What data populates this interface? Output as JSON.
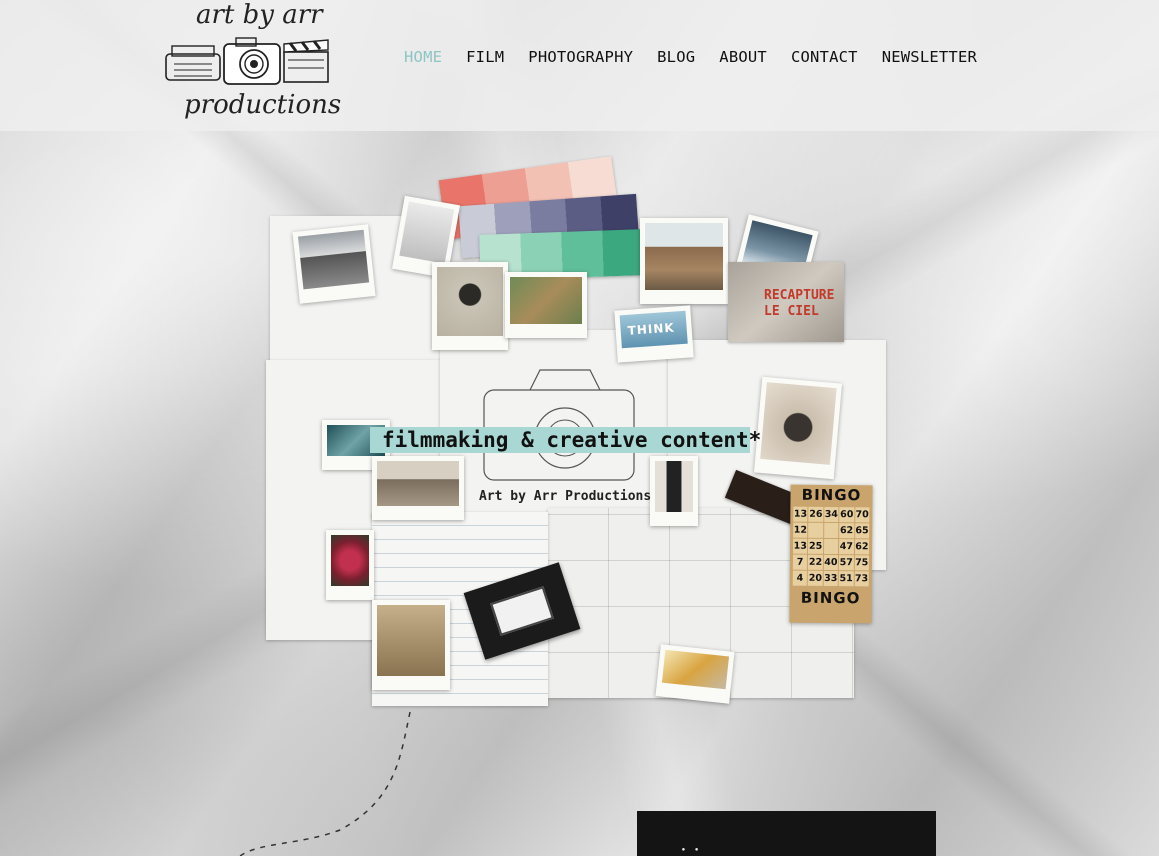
{
  "brand": {
    "logo_line1": "art by arr",
    "logo_line2": "productions",
    "logo_icon": "typewriter-camera-clapperboard-icon"
  },
  "nav": {
    "items": [
      {
        "label": "HOME",
        "active": true
      },
      {
        "label": "FILM",
        "active": false
      },
      {
        "label": "PHOTOGRAPHY",
        "active": false
      },
      {
        "label": "BLOG",
        "active": false
      },
      {
        "label": "ABOUT",
        "active": false
      },
      {
        "label": "CONTACT",
        "active": false
      },
      {
        "label": "NEWSLETTER",
        "active": false
      }
    ],
    "active_color": "#8fc4c4"
  },
  "hero": {
    "tagline": "filmmaking & creative content*",
    "byline": "Art by Arr Productions",
    "tagline_bg": "#a9d7d3",
    "poster_text": "RECAPTURE\nLE CIEL",
    "photo_text": "THINK",
    "bingo": {
      "header": "BINGO",
      "footer": "BINGO",
      "numbers": [
        "13",
        "26",
        "34",
        "60",
        "70",
        "12",
        "",
        "",
        "62",
        "65",
        "13",
        "25",
        "",
        "47",
        "62",
        "7",
        "22",
        "40",
        "57",
        "75",
        "4",
        "20",
        "33",
        "51",
        "73"
      ]
    }
  },
  "footer_box": {
    "partial_glyph": "⸪"
  }
}
